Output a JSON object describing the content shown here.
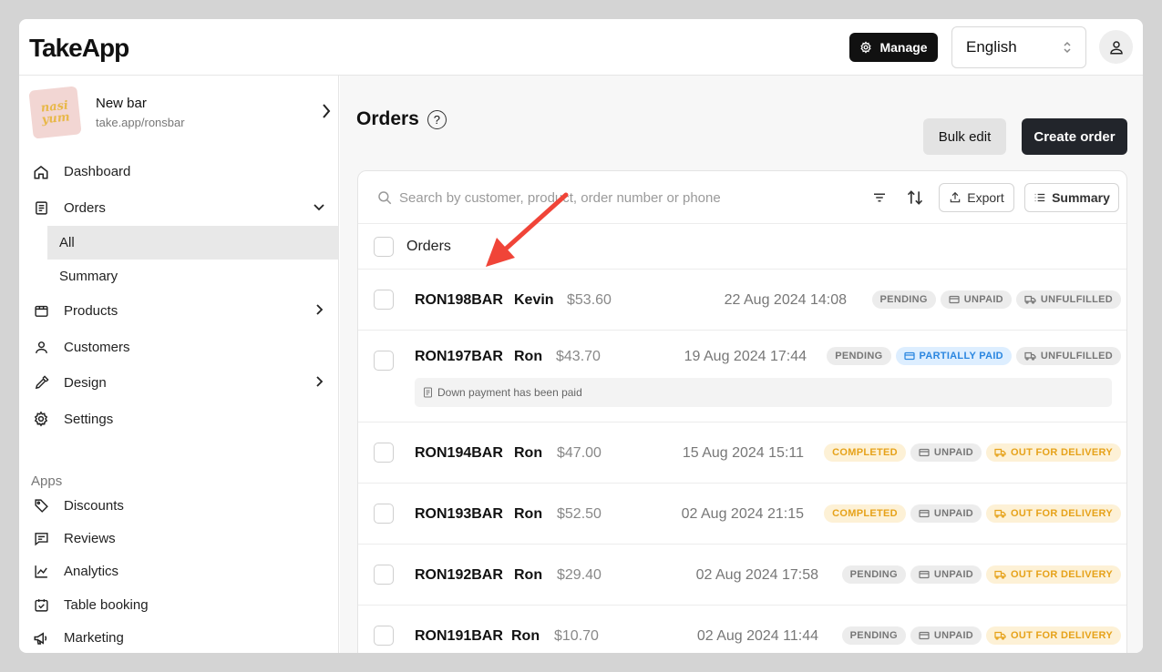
{
  "header": {
    "logo": "TakeApp",
    "manage_label": "Manage",
    "language": "English"
  },
  "store": {
    "logo_text_line1": "nasi",
    "logo_text_line2": "yum",
    "name": "New bar",
    "url": "take.app/ronsbar"
  },
  "nav": {
    "dashboard": "Dashboard",
    "orders": "Orders",
    "orders_all": "All",
    "orders_summary": "Summary",
    "products": "Products",
    "customers": "Customers",
    "design": "Design",
    "settings": "Settings"
  },
  "apps": {
    "title": "Apps",
    "discounts": "Discounts",
    "reviews": "Reviews",
    "analytics": "Analytics",
    "table_booking": "Table booking",
    "marketing": "Marketing"
  },
  "main": {
    "title": "Orders",
    "help_icon": "?",
    "bulk_edit": "Bulk edit",
    "create_order": "Create order",
    "search_placeholder": "Search by customer, product, order number or phone",
    "export": "Export",
    "summary": "Summary",
    "list_header": "Orders"
  },
  "orders": [
    {
      "number": "RON198BAR",
      "customer": "Kevin",
      "amount": "$53.60",
      "date": "22 Aug 2024 14:08",
      "status": "PENDING",
      "payment": "UNPAID",
      "fulfillment": "UNFULFILLED"
    },
    {
      "number": "RON197BAR",
      "customer": "Ron",
      "amount": "$43.70",
      "date": "19 Aug 2024 17:44",
      "status": "PENDING",
      "payment": "PARTIALLY PAID",
      "fulfillment": "UNFULFILLED",
      "note": "Down payment has been paid"
    },
    {
      "number": "RON194BAR",
      "customer": "Ron",
      "amount": "$47.00",
      "date": "15 Aug 2024 15:11",
      "status": "COMPLETED",
      "payment": "UNPAID",
      "fulfillment": "OUT FOR DELIVERY"
    },
    {
      "number": "RON193BAR",
      "customer": "Ron",
      "amount": "$52.50",
      "date": "02 Aug 2024 21:15",
      "status": "COMPLETED",
      "payment": "UNPAID",
      "fulfillment": "OUT FOR DELIVERY"
    },
    {
      "number": "RON192BAR",
      "customer": "Ron",
      "amount": "$29.40",
      "date": "02 Aug 2024 17:58",
      "status": "PENDING",
      "payment": "UNPAID",
      "fulfillment": "OUT FOR DELIVERY"
    },
    {
      "number": "RON191BAR",
      "customer": "Ron",
      "amount": "$10.70",
      "date": "02 Aug 2024 11:44",
      "status": "PENDING",
      "payment": "UNPAID",
      "fulfillment": "OUT FOR DELIVERY"
    }
  ],
  "colors": {
    "annotation_arrow": "#f04438",
    "primary_dark": "#22252b",
    "completed": "#e6a21a",
    "partially_paid": "#2a86e0"
  }
}
